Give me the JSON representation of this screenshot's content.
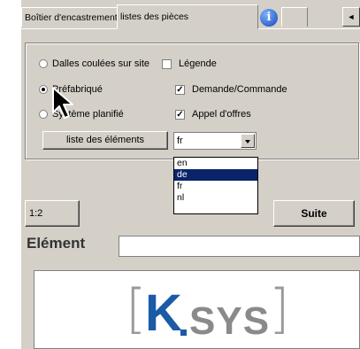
{
  "tabs": [
    {
      "label": "Boîtier d'encastrement",
      "active": false
    },
    {
      "label": "listes des pièces",
      "active": true
    }
  ],
  "info_icon": "i",
  "tab_scroll": "◄",
  "options": {
    "radio_dalles": "Dalles coulées sur site",
    "radio_prefab": "Préfabriqué",
    "radio_third": "Système planifié",
    "check_legende": "Légende",
    "check_demande": "Demande/Commande",
    "check_appel": "Appel d'offres"
  },
  "buttons": {
    "liste": "liste des éléments",
    "scale": "1:2",
    "suite": "Suite"
  },
  "language_select": {
    "value": "fr",
    "options": [
      "en",
      "de",
      "fr",
      "nl"
    ],
    "highlighted": "de"
  },
  "element_label": "Elément",
  "logo": {
    "k": "K",
    "sys": "SYS"
  },
  "colors": {
    "selection": "#0a246a",
    "logo_blue": "#1a5aa6",
    "window": "#d4d0c8"
  }
}
